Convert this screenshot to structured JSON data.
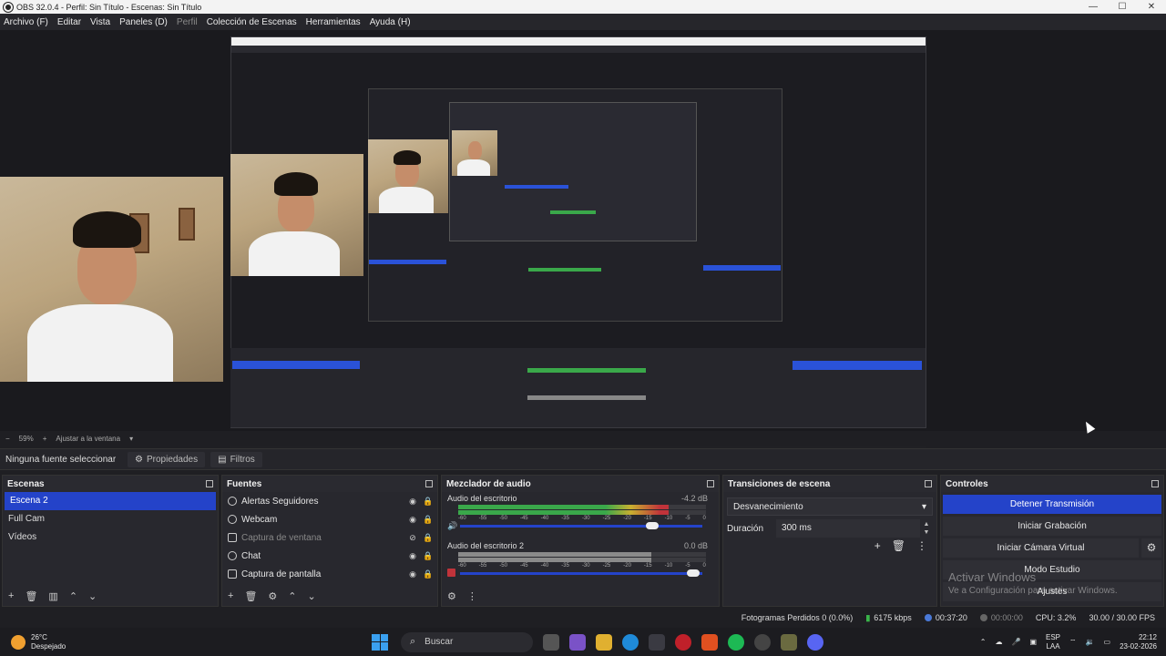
{
  "window": {
    "title": "OBS 32.0.4 - Perfil: Sin Título - Escenas: Sin Título",
    "min": "—",
    "max": "☐",
    "close": "✕"
  },
  "menu": [
    "Archivo (F)",
    "Editar",
    "Vista",
    "Paneles (D)",
    "Perfil",
    "Colección de Escenas",
    "Herramientas",
    "Ayuda (H)"
  ],
  "zoom": {
    "minus": "−",
    "value": "59%",
    "plus": "+",
    "fit": "Ajustar a la ventana",
    "arrow": "▾"
  },
  "source_toolbar": {
    "no_selection": "Ninguna fuente seleccionar",
    "properties": "Propiedades",
    "filters": "Filtros"
  },
  "scenes": {
    "title": "Escenas",
    "items": [
      "Escena 2",
      "Full Cam",
      "Vídeos"
    ],
    "active_index": 0
  },
  "sources": {
    "title": "Fuentes",
    "items": [
      {
        "label": "Alertas Seguidores",
        "visible": true
      },
      {
        "label": "Webcam",
        "visible": true
      },
      {
        "label": "Captura de ventana",
        "visible": false
      },
      {
        "label": "Chat",
        "visible": true
      },
      {
        "label": "Captura de pantalla",
        "visible": true
      }
    ]
  },
  "mixer": {
    "title": "Mezclador de audio",
    "tracks": [
      {
        "name": "Audio del escritorio",
        "db": "-4.2 dB",
        "level": 0.85,
        "slider": 0.82,
        "muted": false
      },
      {
        "name": "Audio del escritorio 2",
        "db": "0.0 dB",
        "level": 0.78,
        "slider": 0.99,
        "muted": true
      }
    ],
    "ticks": [
      "-60",
      "-55",
      "-50",
      "-45",
      "-40",
      "-35",
      "-30",
      "-25",
      "-20",
      "-15",
      "-10",
      "-5",
      "0"
    ]
  },
  "transitions": {
    "title": "Transiciones de escena",
    "selected": "Desvanecimiento",
    "duration_label": "Duración",
    "duration_value": "300 ms"
  },
  "controls": {
    "title": "Controles",
    "stop_stream": "Detener Transmisión",
    "start_record": "Iniciar Grabación",
    "start_virtualcam": "Iniciar Cámara Virtual",
    "studio_mode": "Modo Estudio",
    "settings": "Ajustes",
    "watermark_1": "Activar Windows",
    "watermark_2": "Ve a Configuración para activar Windows."
  },
  "status": {
    "dropped": "Fotogramas Perdidos 0 (0.0%)",
    "bitrate": "6175 kbps",
    "stream_time": "00:37:20",
    "rec_time": "00:00:00",
    "cpu": "CPU: 3.2%",
    "fps": "30.00 / 30.00 FPS"
  },
  "taskbar": {
    "temp": "26°C",
    "weather": "Despejado",
    "search": "Buscar",
    "lang_1": "ESP",
    "lang_2": "LAA",
    "time": "22:12",
    "date": "23-02-2026"
  },
  "colors": {
    "accent": "#2443c9",
    "meter_green": "#3aa84a",
    "meter_yellow": "#c8b030",
    "meter_red": "#c0333a"
  }
}
